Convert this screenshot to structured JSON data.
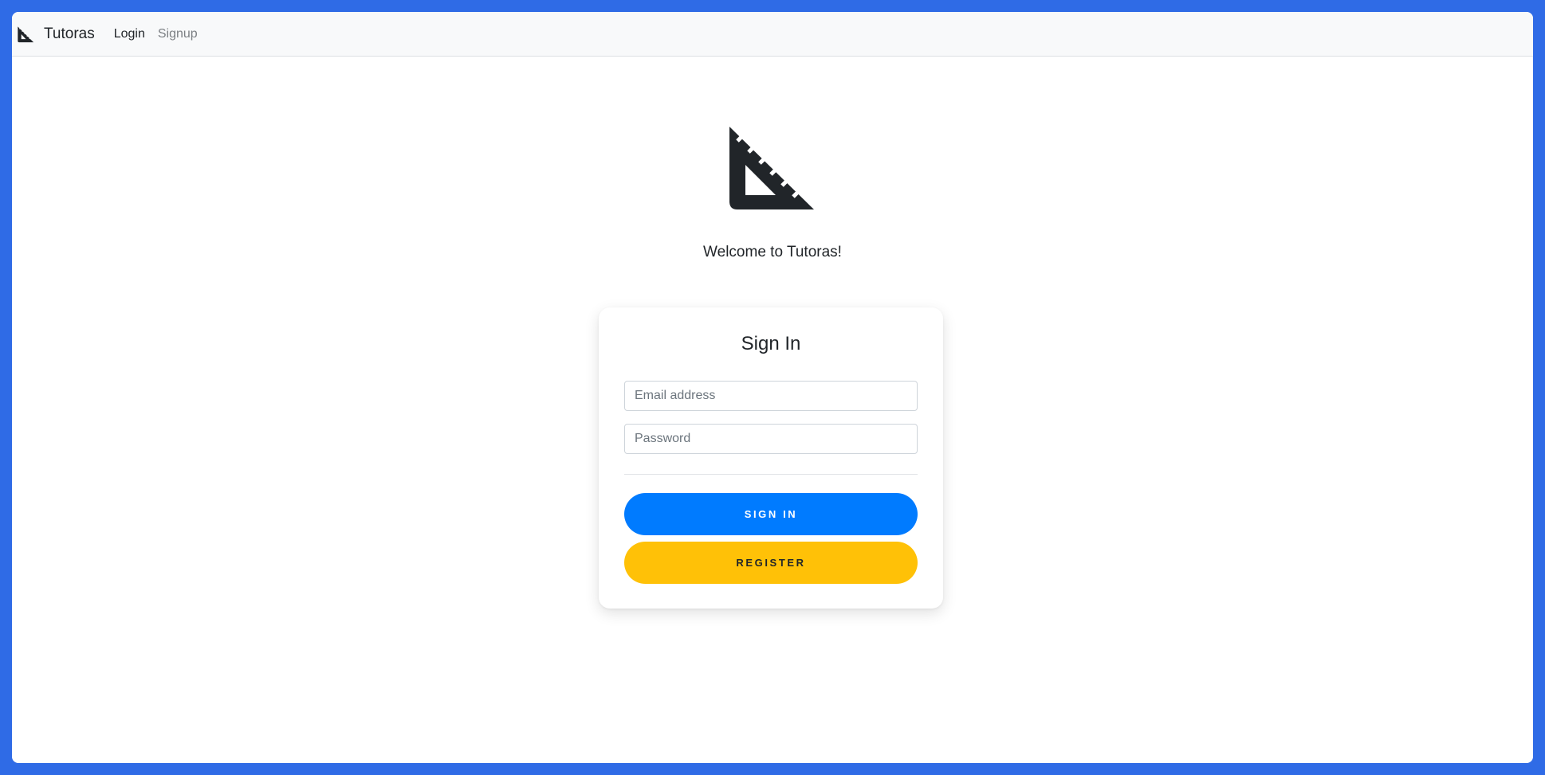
{
  "navbar": {
    "brand_icon": "set-square-ruler-icon",
    "brand_name": "Tutoras",
    "links": [
      {
        "label": "Login",
        "active": true
      },
      {
        "label": "Signup",
        "active": false
      }
    ]
  },
  "hero": {
    "logo_icon": "set-square-ruler-icon",
    "welcome_text": "Welcome to Tutoras!"
  },
  "signin_card": {
    "title": "Sign In",
    "email_placeholder": "Email address",
    "email_value": "",
    "password_placeholder": "Password",
    "password_value": "",
    "signin_label": "SIGN IN",
    "register_label": "REGISTER"
  },
  "colors": {
    "desktop_background": "#2f6be6",
    "primary": "#007bff",
    "warning": "#ffc107",
    "text_dark": "#212529"
  }
}
